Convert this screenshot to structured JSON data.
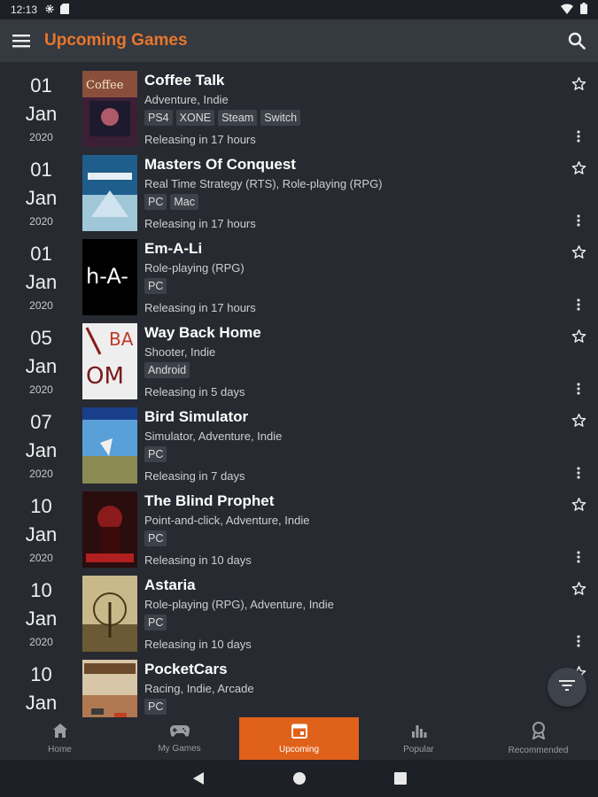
{
  "status_bar": {
    "time": "12:13",
    "icons": [
      "gear-icon",
      "sd-card-icon",
      "wifi-icon",
      "battery-icon"
    ]
  },
  "app_bar": {
    "title": "Upcoming Games",
    "menu_icon": "hamburger-menu-icon",
    "search_icon": "search-icon"
  },
  "colors": {
    "accent": "#e8762b",
    "active_tab": "#e0621a",
    "background": "#272a31",
    "app_bar": "#353940"
  },
  "games": [
    {
      "day": "01",
      "month": "Jan",
      "year": "2020",
      "title": "Coffee Talk",
      "genres": "Adventure, Indie",
      "platforms": [
        "PS4",
        "XONE",
        "Steam",
        "Switch"
      ],
      "release": "Releasing in 17 hours"
    },
    {
      "day": "01",
      "month": "Jan",
      "year": "2020",
      "title": "Masters Of Conquest",
      "genres": "Real Time Strategy (RTS), Role-playing (RPG)",
      "platforms": [
        "PC",
        "Mac"
      ],
      "release": "Releasing in 17 hours"
    },
    {
      "day": "01",
      "month": "Jan",
      "year": "2020",
      "title": "Em-A-Li",
      "genres": "Role-playing (RPG)",
      "platforms": [
        "PC"
      ],
      "release": "Releasing in 17 hours"
    },
    {
      "day": "05",
      "month": "Jan",
      "year": "2020",
      "title": "Way Back Home",
      "genres": "Shooter, Indie",
      "platforms": [
        "Android"
      ],
      "release": "Releasing in 5 days"
    },
    {
      "day": "07",
      "month": "Jan",
      "year": "2020",
      "title": "Bird Simulator",
      "genres": "Simulator, Adventure, Indie",
      "platforms": [
        "PC"
      ],
      "release": "Releasing in 7 days"
    },
    {
      "day": "10",
      "month": "Jan",
      "year": "2020",
      "title": "The Blind Prophet",
      "genres": "Point-and-click, Adventure, Indie",
      "platforms": [
        "PC"
      ],
      "release": "Releasing in 10 days"
    },
    {
      "day": "10",
      "month": "Jan",
      "year": "2020",
      "title": "Astaria",
      "genres": "Role-playing (RPG), Adventure, Indie",
      "platforms": [
        "PC"
      ],
      "release": "Releasing in 10 days"
    },
    {
      "day": "10",
      "month": "Jan",
      "year": "",
      "title": "PocketCars",
      "genres": "Racing, Indie, Arcade",
      "platforms": [
        "PC"
      ],
      "release": ""
    }
  ],
  "bottom_nav": [
    {
      "label": "Home",
      "icon": "home-icon"
    },
    {
      "label": "My Games",
      "icon": "gamepad-icon"
    },
    {
      "label": "Upcoming",
      "icon": "calendar-icon",
      "active": true
    },
    {
      "label": "Popular",
      "icon": "bar-chart-icon"
    },
    {
      "label": "Recommended",
      "icon": "award-icon"
    }
  ],
  "fab": {
    "icon": "filter-icon"
  },
  "system_nav": [
    "back-icon",
    "home-circle-icon",
    "recents-icon"
  ]
}
